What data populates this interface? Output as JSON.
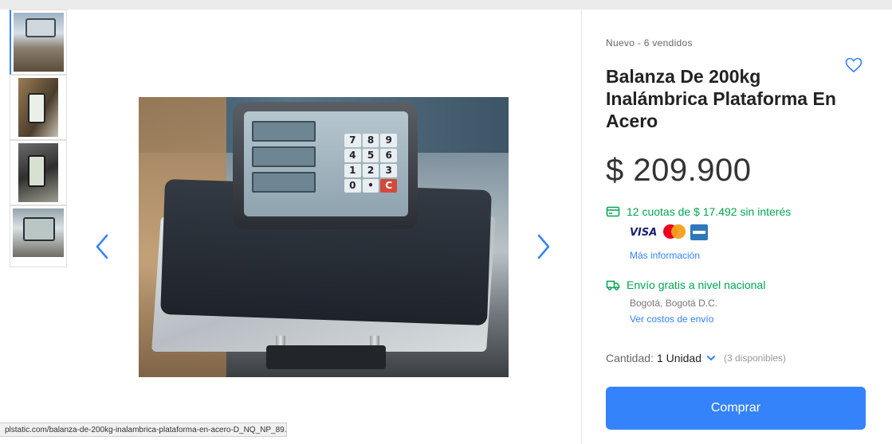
{
  "product": {
    "condition_sold": "Nuevo  -  6 vendidos",
    "title": "Balanza De 200kg Inalámbrica Plataforma En Acero",
    "price": "$ 209.900",
    "installments": "12 cuotas de $ 17.492 sin interés",
    "cards": {
      "visa": "VISA"
    },
    "more_info": "Más información",
    "shipping": "Envío gratis a nivel nacional",
    "location": "Bogotá, Bogotá D.C.",
    "shipping_costs": "Ver costos de envío",
    "quantity_label": "Cantidad:",
    "quantity_value": "1 Unidad",
    "available": "(3 disponibles)",
    "buy_label": "Comprar"
  },
  "keypad": [
    "7",
    "8",
    "9",
    "4",
    "5",
    "6",
    "1",
    "2",
    "3",
    "0",
    "•",
    "C"
  ],
  "status_url": "plstatic.com/balanza-de-200kg-inalambrica-plataforma-en-acero-D_NQ_NP_89...",
  "colors": {
    "accent": "#3483fa",
    "green": "#00a650"
  },
  "icons": {
    "favorite": "heart-icon",
    "installments": "card-icon",
    "shipping": "truck-icon",
    "prev": "chevron-left-icon",
    "next": "chevron-right-icon"
  }
}
